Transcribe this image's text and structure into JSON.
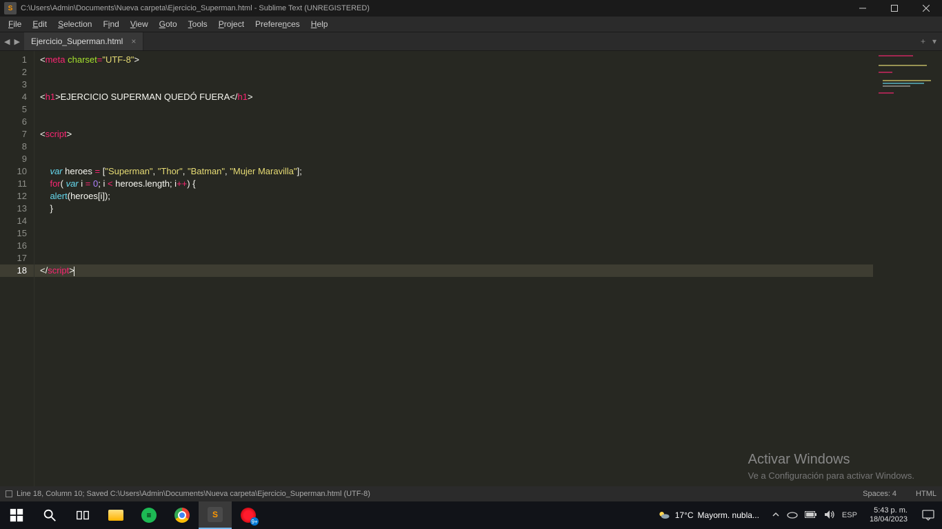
{
  "titlebar": {
    "path": "C:\\Users\\Admin\\Documents\\Nueva carpeta\\Ejercicio_Superman.html - Sublime Text (UNREGISTERED)"
  },
  "menu": {
    "items": [
      {
        "pre": "",
        "ul": "F",
        "post": "ile"
      },
      {
        "pre": "",
        "ul": "E",
        "post": "dit"
      },
      {
        "pre": "",
        "ul": "S",
        "post": "election"
      },
      {
        "pre": "F",
        "ul": "i",
        "post": "nd"
      },
      {
        "pre": "",
        "ul": "V",
        "post": "iew"
      },
      {
        "pre": "",
        "ul": "G",
        "post": "oto"
      },
      {
        "pre": "",
        "ul": "T",
        "post": "ools"
      },
      {
        "pre": "",
        "ul": "P",
        "post": "roject"
      },
      {
        "pre": "Prefere",
        "ul": "n",
        "post": "ces"
      },
      {
        "pre": "",
        "ul": "H",
        "post": "elp"
      }
    ]
  },
  "tab": {
    "name": "Ejercicio_Superman.html"
  },
  "gutter": {
    "lines": [
      "1",
      "2",
      "3",
      "4",
      "5",
      "6",
      "7",
      "8",
      "9",
      "10",
      "11",
      "12",
      "13",
      "14",
      "15",
      "16",
      "17",
      "18"
    ],
    "active": 18
  },
  "code": {
    "l1": {
      "a": "<",
      "b": "meta",
      "c": " ",
      "d": "charset",
      "e": "=",
      "f": "\"UTF-8\"",
      "g": ">"
    },
    "l4": {
      "a": "<",
      "b": "h1",
      "c": ">",
      "d": "EJERCICIO SUPERMAN QUEDÓ FUERA",
      "e": "</",
      "f": "h1",
      "g": ">"
    },
    "l7": {
      "a": "<",
      "b": "script",
      "c": ">"
    },
    "l10": {
      "ind": "    ",
      "a": "var",
      "b": " heroes ",
      "c": "=",
      "d": " [",
      "s1": "\"Superman\"",
      "cm1": ", ",
      "s2": "\"Thor\"",
      "cm2": ", ",
      "s3": "\"Batman\"",
      "cm3": ", ",
      "s4": "\"Mujer Maravilla\"",
      "e": "];"
    },
    "l11": {
      "ind": "    ",
      "a": "for",
      "b": "( ",
      "c": "var",
      "d": " i ",
      "e": "=",
      "f": " ",
      "g": "0",
      "h": "; i ",
      "i": "<",
      "j": " heroes.length; i",
      "k": "++",
      "l": ") {"
    },
    "l12": {
      "ind": "    ",
      "a": "alert",
      "b": "(heroes[i]);"
    },
    "l13": {
      "ind": "    ",
      "a": "}"
    },
    "l18": {
      "a": "</",
      "b": "script",
      "c": ">"
    }
  },
  "status": {
    "left": "Line 18, Column 10; Saved C:\\Users\\Admin\\Documents\\Nueva carpeta\\Ejercicio_Superman.html (UTF-8)",
    "spaces": "Spaces: 4",
    "lang": "HTML"
  },
  "watermark": {
    "title": "Activar Windows",
    "sub": "Ve a Configuración para activar Windows."
  },
  "taskbar": {
    "weather_temp": "17°C",
    "weather_text": "Mayorm. nubla...",
    "lang": "ESP",
    "time": "5:43 p. m.",
    "date": "18/04/2023",
    "opera_badge": "9+"
  }
}
